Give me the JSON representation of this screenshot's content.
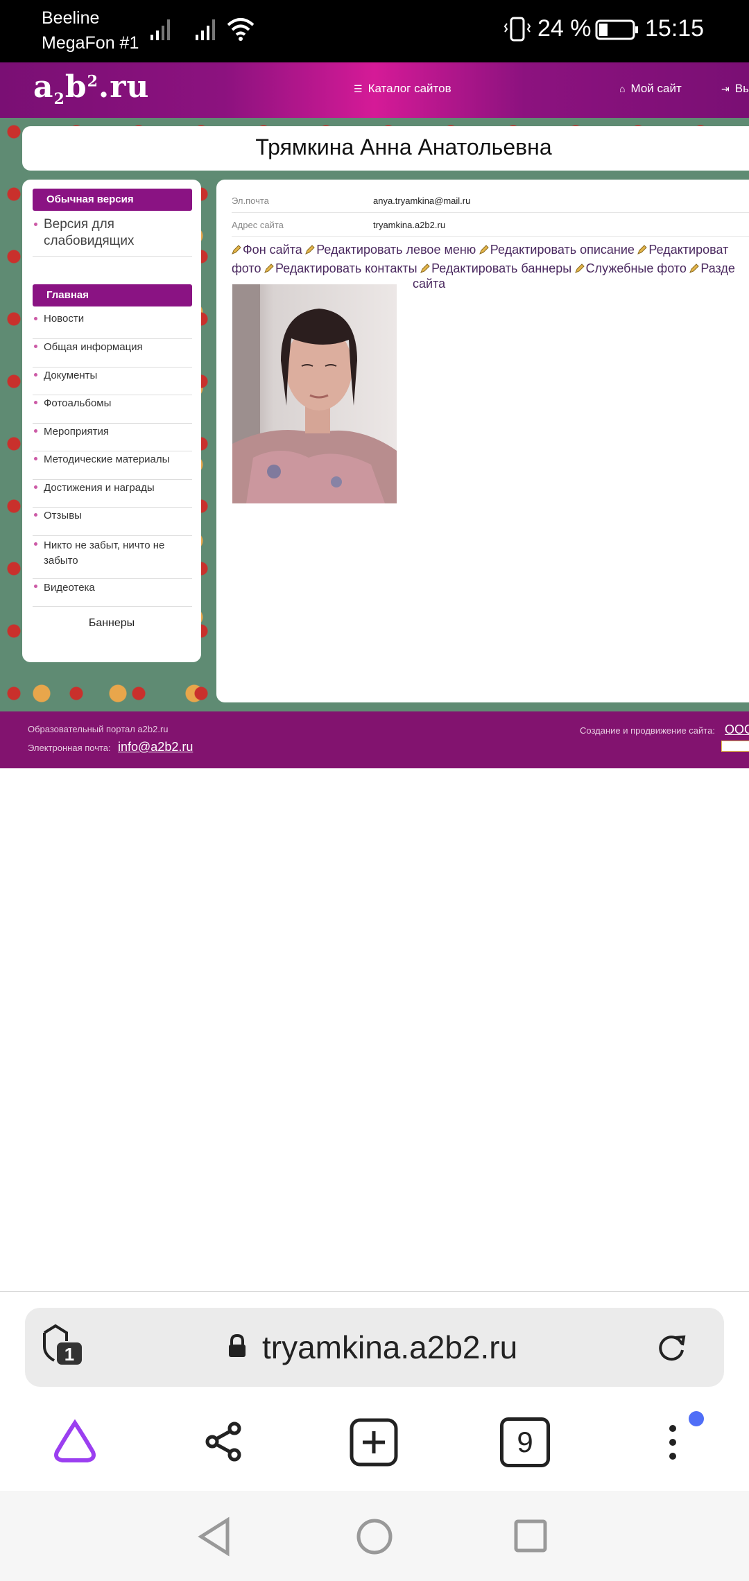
{
  "status_bar": {
    "carrier_1": "Beeline",
    "carrier_2": "MegaFon #1",
    "battery_percent": "24 %",
    "time": "15:15"
  },
  "site_header": {
    "logo": "a2b2.ru",
    "catalog_label": "Каталог сайтов",
    "my_site_label": "Мой сайт",
    "exit_label": "Вы"
  },
  "page_title": "Трямкина Анна Анатольевна",
  "sidebar": {
    "regular_version": "Обычная версия",
    "visually_impaired_version": "Версия для слабовидящих",
    "main_heading": "Главная",
    "items": [
      {
        "label": "Новости"
      },
      {
        "label": "Общая информация"
      },
      {
        "label": "Документы"
      },
      {
        "label": "Фотоальбомы"
      },
      {
        "label": "Мероприятия"
      },
      {
        "label": "Методические материалы"
      },
      {
        "label": "Достижения и награды"
      },
      {
        "label": "Отзывы"
      },
      {
        "label": "Никто не забыт, ничто не забыто"
      },
      {
        "label": "Видеотека"
      }
    ],
    "banners_title": "Баннеры"
  },
  "profile": {
    "email_key": "Эл.почта",
    "email_value": "anya.tryamkina@mail.ru",
    "site_key": "Адрес сайта",
    "site_value": "tryamkina.a2b2.ru"
  },
  "edit_links": {
    "background": "Фон сайта",
    "left_menu": "Редактировать левое меню",
    "description": "Редактировать описание",
    "edit_cut": "Редактироват",
    "photo_tail": "фото",
    "contacts": "Редактировать контакты",
    "banners": "Редактировать баннеры",
    "service_photos": "Служебные фото",
    "sections_cut": "Разде",
    "site_tail": "сайта"
  },
  "footer": {
    "portal": "Образовательный портал a2b2.ru",
    "email_label": "Электронная почта:",
    "email": "info@a2b2.ru",
    "create_label": "Создание и продвижение сайта:",
    "company_cut": "ООО"
  },
  "browser": {
    "tabs_shield_count": "1",
    "url": "tryamkina.a2b2.ru",
    "tab_count": "9"
  },
  "colors": {
    "brand_purple": "#8a1383",
    "header_pink": "#d51a97",
    "alice_purple": "#9b3ff0",
    "notification_dot": "#4f6ef7"
  }
}
